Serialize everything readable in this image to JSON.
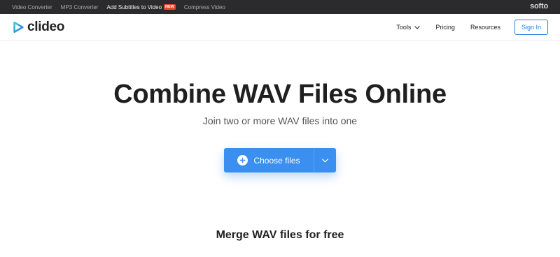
{
  "topbar": {
    "items": [
      {
        "label": "Video Converter"
      },
      {
        "label": "MP3 Converter"
      },
      {
        "label": "Add Subtitles to Video",
        "badge": "NEW"
      },
      {
        "label": "Compress Video"
      }
    ],
    "brand": "softo"
  },
  "header": {
    "logo_text": "clideo",
    "nav": {
      "tools": "Tools",
      "pricing": "Pricing",
      "resources": "Resources",
      "signin": "Sign In"
    }
  },
  "hero": {
    "title": "Combine WAV Files Online",
    "subtitle": "Join two or more WAV files into one",
    "choose_label": "Choose files"
  },
  "section": {
    "merge_title": "Merge WAV files for free"
  },
  "colors": {
    "accent": "#3b8ff0",
    "topbar_bg": "#2b2b2d",
    "new_badge": "#e8472e"
  }
}
